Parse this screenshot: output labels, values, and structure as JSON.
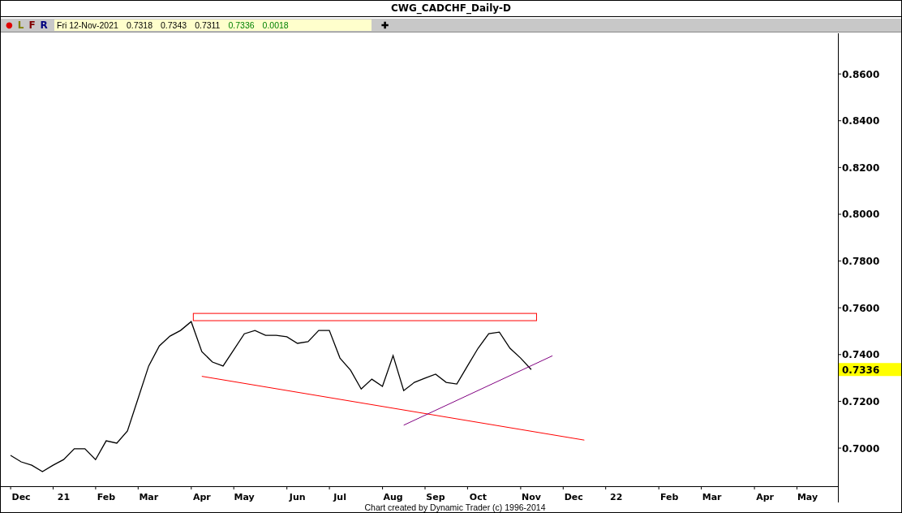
{
  "window": {
    "title": "CWG_CADCHF_Daily-D"
  },
  "toolbar": {
    "buttons": [
      {
        "label": "●",
        "kind": "dot"
      },
      {
        "label": "L",
        "kind": "l"
      },
      {
        "label": "F",
        "kind": "f"
      },
      {
        "label": "R",
        "kind": "r"
      }
    ],
    "quote": [
      {
        "text": "Fri 12-Nov-2021",
        "kind": "plain"
      },
      {
        "text": "0.7318",
        "kind": "plain"
      },
      {
        "text": "0.7343",
        "kind": "plain"
      },
      {
        "text": "0.7311",
        "kind": "plain"
      },
      {
        "text": "0.7336",
        "kind": "change"
      },
      {
        "text": "0.0018",
        "kind": "change"
      }
    ],
    "add_button": "✚"
  },
  "chart": {
    "price_marker": "0.7336",
    "chart_data": {
      "type": "line",
      "ylim": [
        0.6837,
        0.8774
      ],
      "yticks": [
        {
          "value": 0.7,
          "label": "0.7000"
        },
        {
          "value": 0.72,
          "label": "0.7200"
        },
        {
          "value": 0.74,
          "label": "0.7400"
        },
        {
          "value": 0.76,
          "label": "0.7600"
        },
        {
          "value": 0.78,
          "label": "0.7800"
        },
        {
          "value": 0.8,
          "label": "0.8000"
        },
        {
          "value": 0.82,
          "label": "0.8200"
        },
        {
          "value": 0.84,
          "label": "0.8400"
        },
        {
          "value": 0.86,
          "label": "0.8600"
        }
      ],
      "categories": [
        null,
        "Dec",
        null,
        null,
        null,
        "21",
        null,
        null,
        null,
        "Feb",
        null,
        null,
        null,
        "Mar",
        null,
        null,
        null,
        null,
        "Apr",
        null,
        null,
        null,
        "May",
        null,
        null,
        null,
        null,
        "Jun",
        null,
        null,
        null,
        "Jul",
        null,
        null,
        null,
        null,
        "Aug",
        null,
        null,
        null,
        "Sep",
        null,
        null,
        null,
        "Oct",
        null,
        null,
        null,
        null,
        "Nov",
        null,
        null,
        null,
        "Dec",
        null,
        null,
        null,
        "22",
        null,
        null,
        null,
        null,
        "Feb",
        null,
        null,
        null,
        "Mar",
        null,
        null,
        null,
        null,
        "Apr",
        null,
        null,
        null,
        "May",
        null,
        null
      ],
      "series": [
        {
          "color": "#000000",
          "values": [
            0.6969,
            0.6941,
            0.6927,
            0.6899,
            0.6927,
            0.6951,
            0.6997,
            0.6997,
            0.6951,
            0.7031,
            0.7021,
            0.7073,
            0.7212,
            0.7351,
            0.7437,
            0.7479,
            0.7503,
            0.7541,
            0.7413,
            0.7368,
            0.7351,
            0.742,
            0.7489,
            0.7503,
            0.7482,
            0.7482,
            0.7476,
            0.7448,
            0.7455,
            0.7503,
            0.7503,
            0.7385,
            0.7333,
            0.7253,
            0.7295,
            0.7264,
            0.7396,
            0.7246,
            0.7281,
            0.7299,
            0.7316,
            0.7281,
            0.7274,
            0.7351,
            0.7427,
            0.7489,
            0.7496,
            0.7427,
            0.7385,
            0.7336,
            null,
            null,
            null,
            null,
            null,
            null,
            null,
            null,
            null,
            null,
            null,
            null,
            null,
            null,
            null,
            null,
            null,
            null,
            null,
            null,
            null,
            null,
            null,
            null,
            null,
            null,
            null,
            null
          ]
        },
        {
          "color": "#ff0000",
          "values": [
            null,
            null,
            null,
            null,
            null,
            null,
            null,
            null,
            null,
            null,
            null,
            null,
            null,
            null,
            null,
            null,
            null,
            null,
            0.7307,
            null,
            null,
            null,
            null,
            null,
            null,
            null,
            null,
            null,
            null,
            null,
            null,
            null,
            null,
            null,
            null,
            null,
            null,
            null,
            null,
            null,
            null,
            null,
            null,
            null,
            null,
            null,
            null,
            null,
            null,
            null,
            null,
            null,
            null,
            null,
            0.7034,
            null,
            null,
            null,
            null,
            null,
            null,
            null,
            null,
            null,
            null,
            null,
            null,
            null,
            null,
            null,
            null,
            null,
            null,
            null,
            null,
            null,
            null,
            null
          ]
        },
        {
          "color": "#800080",
          "values": [
            null,
            null,
            null,
            null,
            null,
            null,
            null,
            null,
            null,
            null,
            null,
            null,
            null,
            null,
            null,
            null,
            null,
            null,
            null,
            null,
            null,
            null,
            null,
            null,
            null,
            null,
            null,
            null,
            null,
            null,
            null,
            null,
            null,
            null,
            null,
            null,
            null,
            0.7098,
            null,
            null,
            null,
            null,
            null,
            null,
            null,
            null,
            null,
            null,
            null,
            null,
            null,
            0.7395,
            null,
            null,
            null,
            null,
            null,
            null,
            null,
            null,
            null,
            null,
            null,
            null,
            null,
            null,
            null,
            null,
            null,
            null,
            null,
            null,
            null,
            null,
            null,
            null,
            null,
            null
          ]
        }
      ]
    },
    "overlays": [
      {
        "kind": "rect",
        "color": "#ff0000"
      }
    ]
  },
  "footer": "Chart created by Dynamic Trader  (c) 1996-2014"
}
